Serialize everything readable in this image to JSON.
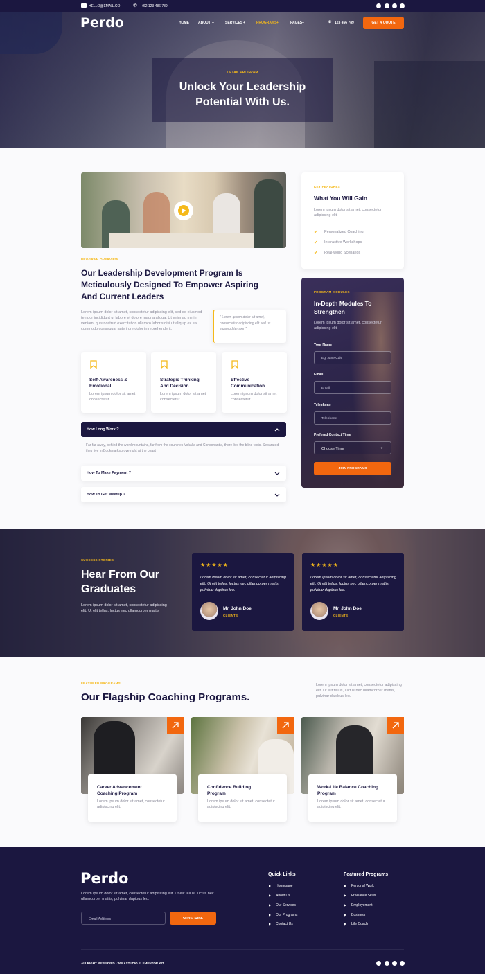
{
  "topbar": {
    "email": "HELLO@EMAIL.CO",
    "phone": "+62 123 486 789"
  },
  "brand": {
    "logo": "Perdo"
  },
  "nav": {
    "items": [
      "HOME",
      "ABOUT",
      "SERVICES",
      "PROGRAMS",
      "PAGES"
    ],
    "phone": "123 456 789",
    "cta": "GET A QUOTE"
  },
  "hero": {
    "eyebrow": "DETAIL PROGRAM",
    "title_line1": "Unlock Your Leadership",
    "title_line2": "Potential With Us."
  },
  "overview": {
    "eyebrow": "PROGRAM OVERVIEW",
    "title_line1": "Our Leadership Development Program Is",
    "title_line2": "Meticulously Designed To Empower Aspiring",
    "title_line3": "And Current Leaders",
    "body": "Lorem ipsum dolor sit amet, consectetur adipiscing elit, sed do eiusmod tempor incididunt ut labore et dolore magna aliqua. Ut enim ad minim veniam, quis nostrud exercitation ullamco laboris nisi ut aliquip ex ea commodo consequat aute irure dolor in reprehenderit.",
    "quote": "\" Lorem ipsum dolor sit amet, consectetur adipiscing elit sed us eiusmod tempor \""
  },
  "features": [
    {
      "title_a": "Self-Awareness &",
      "title_b": "Emotional",
      "text": "Lorem ipsum dolor sit amet consectetur."
    },
    {
      "title_a": "Strategic Thinking",
      "title_b": "And Decision",
      "text": "Lorem ipsum dolor sit amet consectetur."
    },
    {
      "title_a": "Effective",
      "title_b": "Communication",
      "text": "Lorem ipsum dolor sit amet consectetur."
    }
  ],
  "faq": [
    {
      "q": "How Long Work ?",
      "a": "Far far away, behind the word mountains, far from the countries Vokalia and Consonantia, there live the blind texts. Separated they live in Bookmarksgrove right at the coast"
    },
    {
      "q": "How To Make Payment ?"
    },
    {
      "q": "How To Get Meetup ?"
    }
  ],
  "gain": {
    "eyebrow": "KEY FEATURES",
    "title": "What You Will Gain",
    "text": "Lorem ipsum dolor sit amet, consectetur adipiscing elit.",
    "items": [
      "Personalized Coaching",
      "Interactive Workshops",
      "Real-world Scenarios"
    ]
  },
  "form": {
    "eyebrow": "PROGRAM MODULES",
    "title_line1": "In-Depth Modules To",
    "title_line2": "Strengthen",
    "text": "Lorem ipsum dolor sit amet, consectetur adipiscing elit.",
    "name_label": "Your Name",
    "name_ph": "Eg. Jane Cale",
    "email_label": "Email",
    "email_ph": "Email",
    "tel_label": "Telephone",
    "tel_ph": "Telephone",
    "time_label": "Prefered Contact Time",
    "time_value": "Choose Time",
    "submit": "JOIN PROGRAMS"
  },
  "stories": {
    "eyebrow": "SUCCESS STORIES",
    "title_line1": "Hear From Our",
    "title_line2": "Graduates",
    "text": "Lorem ipsum dolor sit amet, consectetur adipiscing elit. Ut elit tellus, luctus nec ullamcorper mattis",
    "stars": "★★★★★",
    "cards": [
      {
        "quote": "Lorem ipsum dolor sit amet, consectetur adipiscing elit. Ut elit tellus, luctus nec ullamcorper mattis, pulvinar dapibus leo.",
        "name": "Mr. John Doe",
        "role": "CLIENTS"
      },
      {
        "quote": "Lorem ipsum dolor sit amet, consectetur adipiscing elit. Ut elit tellus, luctus nec ullamcorper mattis, pulvinar dapibus leo.",
        "name": "Mr. John Doe",
        "role": "CLIENTS"
      }
    ]
  },
  "programs": {
    "eyebrow": "FEATURED PROGRAMS",
    "title": "Our Flagship Coaching Programs.",
    "text": "Lorem ipsum dolor sit amet, consectetur adipiscing elit. Ut elit tellus, luctus nec ullamcorper mattis, pulvinar dapibus leo.",
    "cards": [
      {
        "title_a": "Career Advancement",
        "title_b": "Coaching Program",
        "text": "Lorem ipsum dolor sit amet, consectetur adipiscing elit."
      },
      {
        "title_a": "Confidence Building",
        "title_b": "Program",
        "text": "Lorem ipsum dolor sit amet, consectetur adipiscing elit."
      },
      {
        "title_a": "Work-Life Balance Coaching",
        "title_b": "Program",
        "text": "Lorem ipsum dolor sit amet, consectetur adipiscing elit."
      }
    ]
  },
  "footer": {
    "logo": "Perdo",
    "text": "Lorem ipsum dolor sit amet, consectetur adipiscing elit. Ut elit tellus, luctus nec ullamcorper mattis, pulvinar dapibus leo.",
    "email_ph": "Email Address",
    "subscribe": "SUBSCRIBE",
    "quick_title": "Quick Links",
    "quick": [
      "Homepage",
      "About Us",
      "Our Services",
      "Our Programs",
      "Contact Us"
    ],
    "featured_title": "Featured Programs",
    "featured": [
      "Personal Work",
      "Freelance Skills",
      "Employement",
      "Business",
      "Life Coach"
    ],
    "copyright": "ALLRIGHT RESERVED - WIRASTUDIO ELEMENTOR KIT"
  },
  "colors": {
    "navy": "#1b1740",
    "orange": "#f2670f",
    "yellow": "#f5b91a"
  },
  "icons": [
    "mail-icon",
    "phone-icon",
    "facebook-icon",
    "twitter-icon",
    "youtube-icon",
    "pinterest-icon",
    "play-icon",
    "bookmark-icon",
    "check-icon",
    "chevron-up-icon",
    "chevron-down-icon",
    "arrow-up-right-icon",
    "triangle-right-icon"
  ]
}
